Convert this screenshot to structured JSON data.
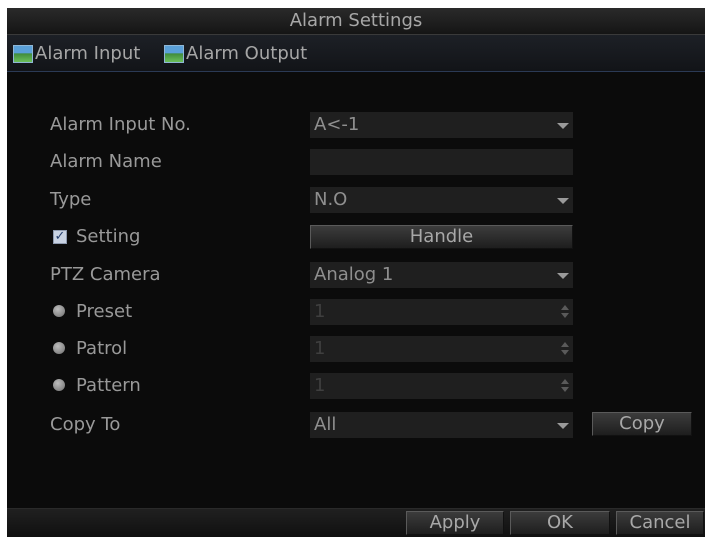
{
  "window": {
    "title": "Alarm Settings"
  },
  "tabs": [
    {
      "label": "Alarm Input",
      "icon": "image-icon"
    },
    {
      "label": "Alarm Output",
      "icon": "image-icon"
    }
  ],
  "form": {
    "alarm_input_no": {
      "label": "Alarm Input No.",
      "value": "A<-1"
    },
    "alarm_name": {
      "label": "Alarm Name",
      "value": ""
    },
    "type": {
      "label": "Type",
      "value": "N.O"
    },
    "setting": {
      "label": "Setting",
      "checked": true,
      "button_label": "Handle"
    },
    "ptz_camera": {
      "label": "PTZ Camera",
      "value": "Analog 1"
    },
    "preset": {
      "label": "Preset",
      "value": "1"
    },
    "patrol": {
      "label": "Patrol",
      "value": "1"
    },
    "pattern": {
      "label": "Pattern",
      "value": "1"
    },
    "copy_to": {
      "label": "Copy To",
      "value": "All",
      "button_label": "Copy"
    }
  },
  "footer": {
    "apply_label": "Apply",
    "ok_label": "OK",
    "cancel_label": "Cancel"
  }
}
